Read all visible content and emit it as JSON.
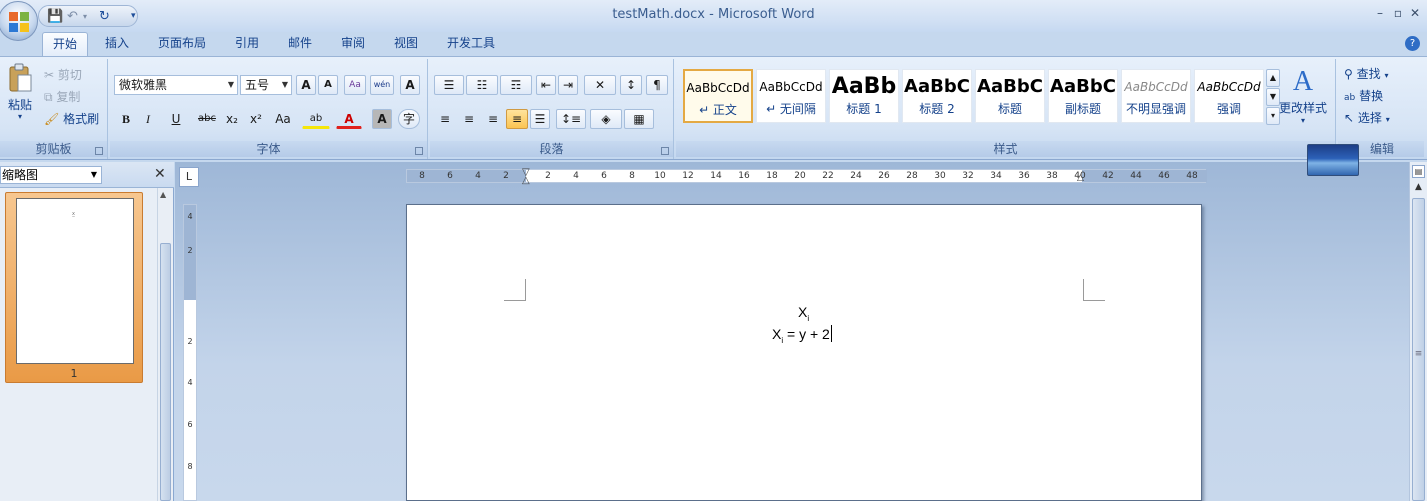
{
  "window": {
    "title": "testMath.docx - Microsoft Word",
    "minimize": "–",
    "restore": "▫",
    "close": "✕"
  },
  "qat": {
    "save": "💾",
    "undo": "↶",
    "undo_arrow": "▾",
    "redo": "↻",
    "customize": "▾"
  },
  "tabs": [
    {
      "label": "开始",
      "active": true
    },
    {
      "label": "插入"
    },
    {
      "label": "页面布局"
    },
    {
      "label": "引用"
    },
    {
      "label": "邮件"
    },
    {
      "label": "审阅"
    },
    {
      "label": "视图"
    },
    {
      "label": "开发工具"
    }
  ],
  "help": "?",
  "clipboard": {
    "label": "剪贴板",
    "paste": "粘贴",
    "cut": "剪切",
    "copy": "复制",
    "format_painter": "格式刷"
  },
  "font": {
    "label": "字体",
    "family": "微软雅黑",
    "size": "五号",
    "grow": "A",
    "shrink": "A",
    "clear": "Aa",
    "phonetic": "wén",
    "border": "A",
    "bold": "B",
    "italic": "I",
    "underline": "U",
    "strike": "abc",
    "subscript": "x₂",
    "superscript": "x²",
    "case": "Aa",
    "highlight": "ab",
    "color": "A",
    "shade": "A",
    "enclose": "字"
  },
  "paragraph": {
    "label": "段落"
  },
  "styles": {
    "label": "样式",
    "change": "更改样式",
    "items": [
      {
        "sample": "AaBbCcDd",
        "name": "↵ 正文",
        "selected": true
      },
      {
        "sample": "AaBbCcDd",
        "name": "↵ 无间隔"
      },
      {
        "sample": "AaBb",
        "name": "标题 1"
      },
      {
        "sample": "AaBbC",
        "name": "标题 2"
      },
      {
        "sample": "AaBbC",
        "name": "标题"
      },
      {
        "sample": "AaBbC",
        "name": "副标题"
      },
      {
        "sample": "AaBbCcDd",
        "name": "不明显强调"
      },
      {
        "sample": "AaBbCcDd",
        "name": "强调"
      }
    ]
  },
  "editing": {
    "label": "编辑",
    "find": "查找",
    "replace": "替换",
    "select": "选择"
  },
  "thumbnail": {
    "view": "缩略图",
    "page_number": "1"
  },
  "ruler": {
    "h_ticks": [
      "8",
      "6",
      "4",
      "2",
      "2",
      "4",
      "6",
      "8",
      "10",
      "12",
      "14",
      "16",
      "18",
      "20",
      "22",
      "24",
      "26",
      "28",
      "30",
      "32",
      "34",
      "36",
      "38",
      "40",
      "42",
      "44",
      "46",
      "48"
    ],
    "v_ticks": [
      "4",
      "2",
      "2",
      "4",
      "6",
      "8"
    ],
    "corner": "L"
  },
  "document": {
    "line1": {
      "var": "X",
      "sub": "i"
    },
    "line2": {
      "var": "X",
      "sub": "i",
      "rest": " = y + 2"
    }
  }
}
